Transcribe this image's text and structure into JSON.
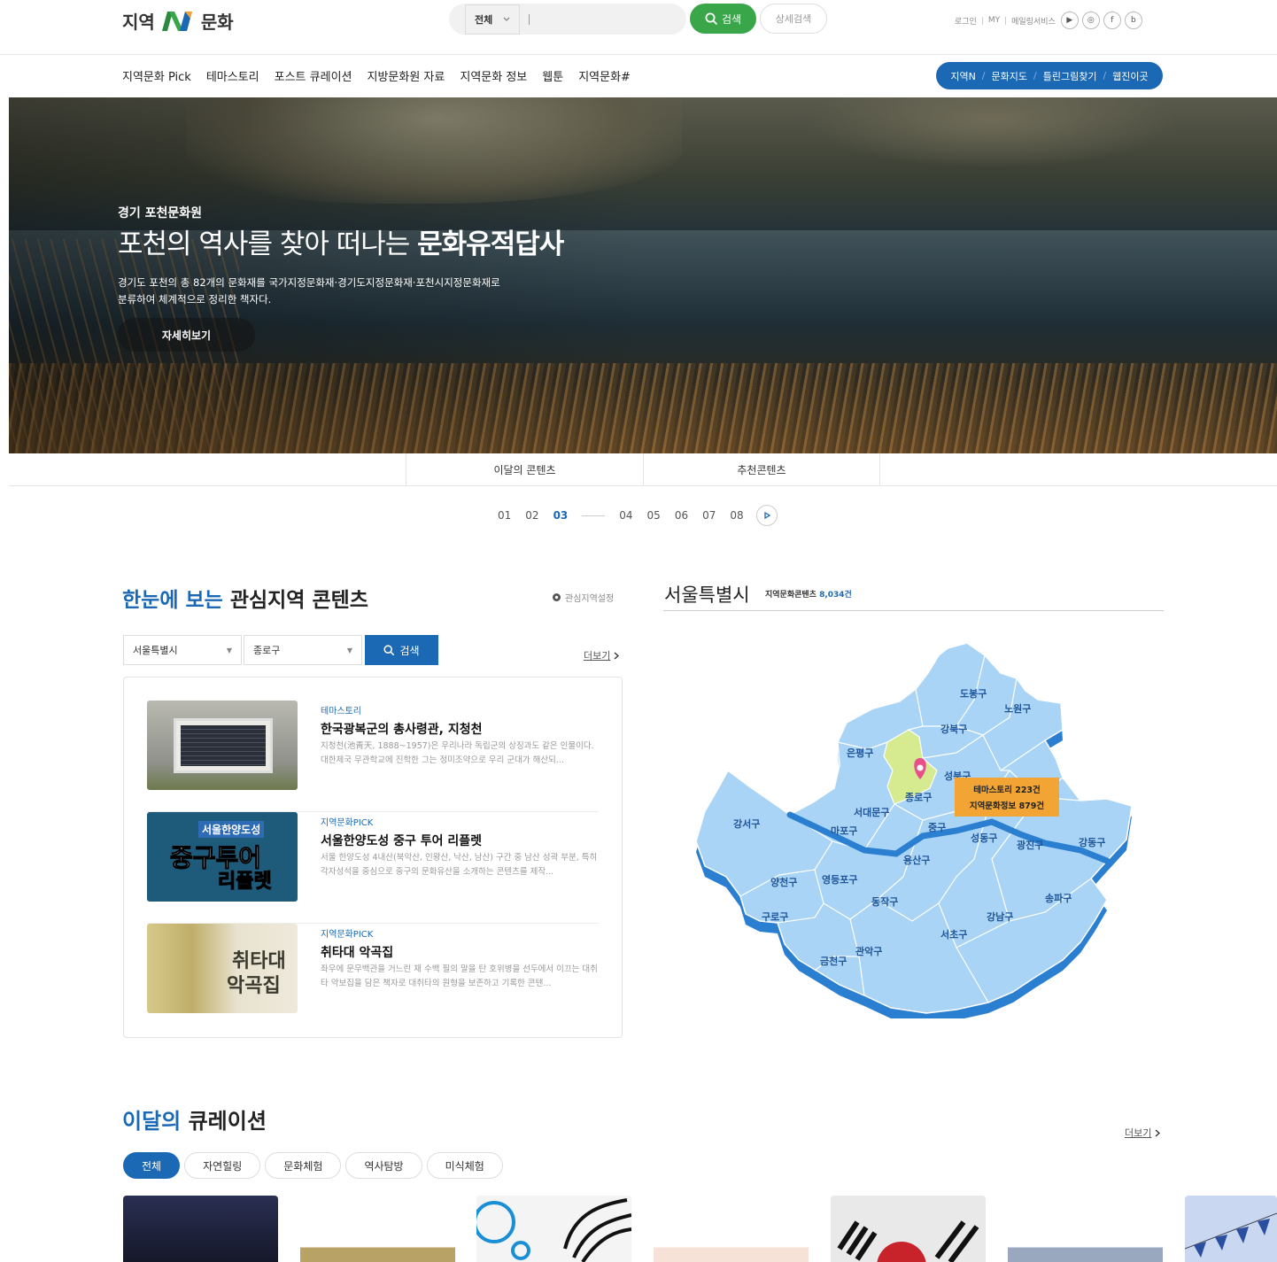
{
  "header": {
    "logo_left": "지역",
    "logo_right": "문화",
    "search": {
      "scope": "전체",
      "placeholder": "",
      "button": "검색",
      "advanced": "상세검색"
    },
    "util": {
      "login": "로그인",
      "my": "MY",
      "mail": "메일링서비스"
    },
    "social": [
      "youtube-icon",
      "instagram-icon",
      "facebook-icon",
      "blog-icon"
    ],
    "social_glyphs": [
      "▶",
      "◎",
      "f",
      "b"
    ]
  },
  "gnb": [
    "지역문화 Pick",
    "테마스토리",
    "포스트 큐레이션",
    "지방문화원 자료",
    "지역문화 정보",
    "웹툰",
    "지역문화#"
  ],
  "quick_links": [
    "지역N",
    "문화지도",
    "틀린그림찾기",
    "웹진이곳"
  ],
  "hero": {
    "org": "경기 포천문화원",
    "title_light": "포천의 역사를 찾아 떠나는 ",
    "title_bold": "문화유적답사",
    "desc_line1": "경기도 포천의 총 82개의 문화재를 국가지정문화재·경기도지정문화재·포천시지정문화재로",
    "desc_line2": "분류하여 체계적으로 정리한 책자다.",
    "more": "자세히보기"
  },
  "content_tabs": [
    "이달의 콘텐츠",
    "추천콘텐츠"
  ],
  "pager": {
    "before": [
      "01",
      "02",
      "03"
    ],
    "after": [
      "04",
      "05",
      "06",
      "07",
      "08"
    ],
    "current": "03"
  },
  "region": {
    "title_blue": "한눈에 보는",
    "title_rest": " 관심지역 콘텐츠",
    "setting": "관심지역설정",
    "select_city": "서울특별시",
    "select_district": "종로구",
    "search": "검색",
    "more": "더보기",
    "items": [
      {
        "category": "테마스토리",
        "title": "한국광복군의 총사령관, 지청천",
        "desc": "지청천(池靑天, 1888~1957)은 우리나라 독립군의 상징과도 같은 인물이다. 대한제국 무관학교에 진학한 그는 정미조약으로 우리 군대가 해산되..."
      },
      {
        "category": "지역문화PICK",
        "title": "서울한양도성 중구 투어 리플렛",
        "desc": "서울 한양도성 4내산(북악산, 인왕산, 낙산, 남산) 구간 중 남산 성곽 부분, 특히 각자성석을 중심으로 중구의 문화유산을 소개하는 콘텐츠를 제작..."
      },
      {
        "category": "지역문화PICK",
        "title": "취타대 악곡집",
        "desc": "좌우에 문무백관을 거느린 채 수백 필의 말을 탄 호위병을 선두에서 이끄는 대취타 악보집을 담은 책자로 대취타의 원형을 보존하고 기록한 콘텐..."
      }
    ],
    "thumb_texts": {
      "t2_a": "서울한양도성",
      "t2_b": "중구투어",
      "t2_c": "리플렛",
      "t3_a": "취타대",
      "t3_b": "악곡집"
    }
  },
  "map": {
    "title": "서울특별시",
    "count_label": "지역문화콘텐츠 ",
    "count_value": "8,034건",
    "tooltip_line1": "테마스토리 223건",
    "tooltip_line2": "지역문화정보 879건",
    "districts": [
      "도봉구",
      "노원구",
      "강북구",
      "은평구",
      "성북구",
      "종로구",
      "서대문구",
      "마포구",
      "중구",
      "성동구",
      "광진구",
      "강동구",
      "강서구",
      "용산구",
      "양천구",
      "영등포구",
      "동작구",
      "송파구",
      "구로구",
      "강남구",
      "서초구",
      "관악구",
      "금천구"
    ],
    "colors": {
      "district": "#a9d4f5",
      "side": "#2b7fd1",
      "selected": "#d6eb8f",
      "marker": "#e8508a",
      "tooltip": "#f2a534"
    }
  },
  "curation": {
    "title_blue": "이달의",
    "title_rest": " 큐레이션",
    "more": "더보기",
    "chips": [
      "전체",
      "자연힐링",
      "문화체험",
      "역사탐방",
      "미식체험"
    ]
  },
  "colors": {
    "brand": "#1b68b4",
    "search_green": "#3aa64a"
  }
}
